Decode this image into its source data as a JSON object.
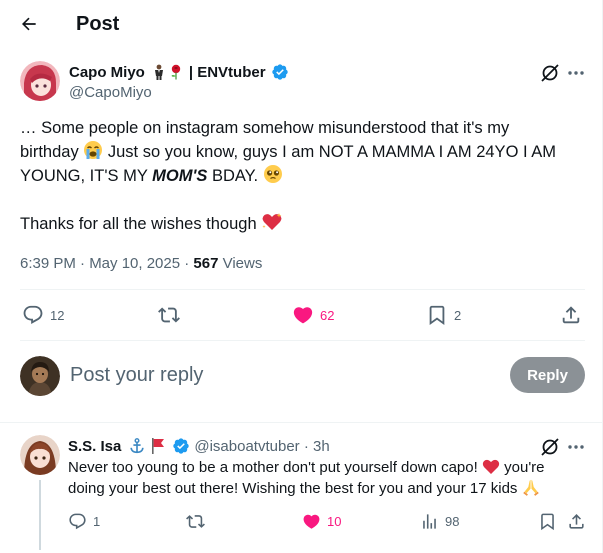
{
  "header": {
    "title": "Post"
  },
  "tweet": {
    "author": {
      "name": "Capo Miyo",
      "name_suffix": "| ENVtuber",
      "handle": "@CapoMiyo"
    },
    "text": {
      "line1": "… Some people on instagram somehow misunderstood that it's my",
      "line2": "birthday",
      "line3_a": " Just so you know, guys I am NOT A MAMMA I AM 24YO I AM",
      "line4_a": "YOUNG, IT'S MY ",
      "line4_bold": "MOM'S",
      "line4_b": " BDAY.",
      "line5": "Thanks for all the wishes though"
    },
    "meta": {
      "time": "6:39 PM · May 10, 2025 · ",
      "views_count": "567",
      "views_label": " Views"
    },
    "actions": {
      "replies": "12",
      "likes": "62",
      "bookmarks": "2"
    }
  },
  "composer": {
    "placeholder": "Post your reply",
    "button_label": "Reply"
  },
  "reply": {
    "name": "S.S. Isa",
    "handle_time": "@isaboatvtuber · 3h",
    "text_line1": "Never too young to be a mother don't put yourself down capo!",
    "text_line1b": " you're",
    "text_line2": "doing your best out there! Wishing the best for you and your 17 kids",
    "actions": {
      "replies": "1",
      "likes": "10",
      "views": "98"
    }
  },
  "colors": {
    "accent": "#1d9bf0",
    "like_pink": "#f91880",
    "secondary_text": "#536471",
    "reply_button_disabled": "#8b9196"
  }
}
